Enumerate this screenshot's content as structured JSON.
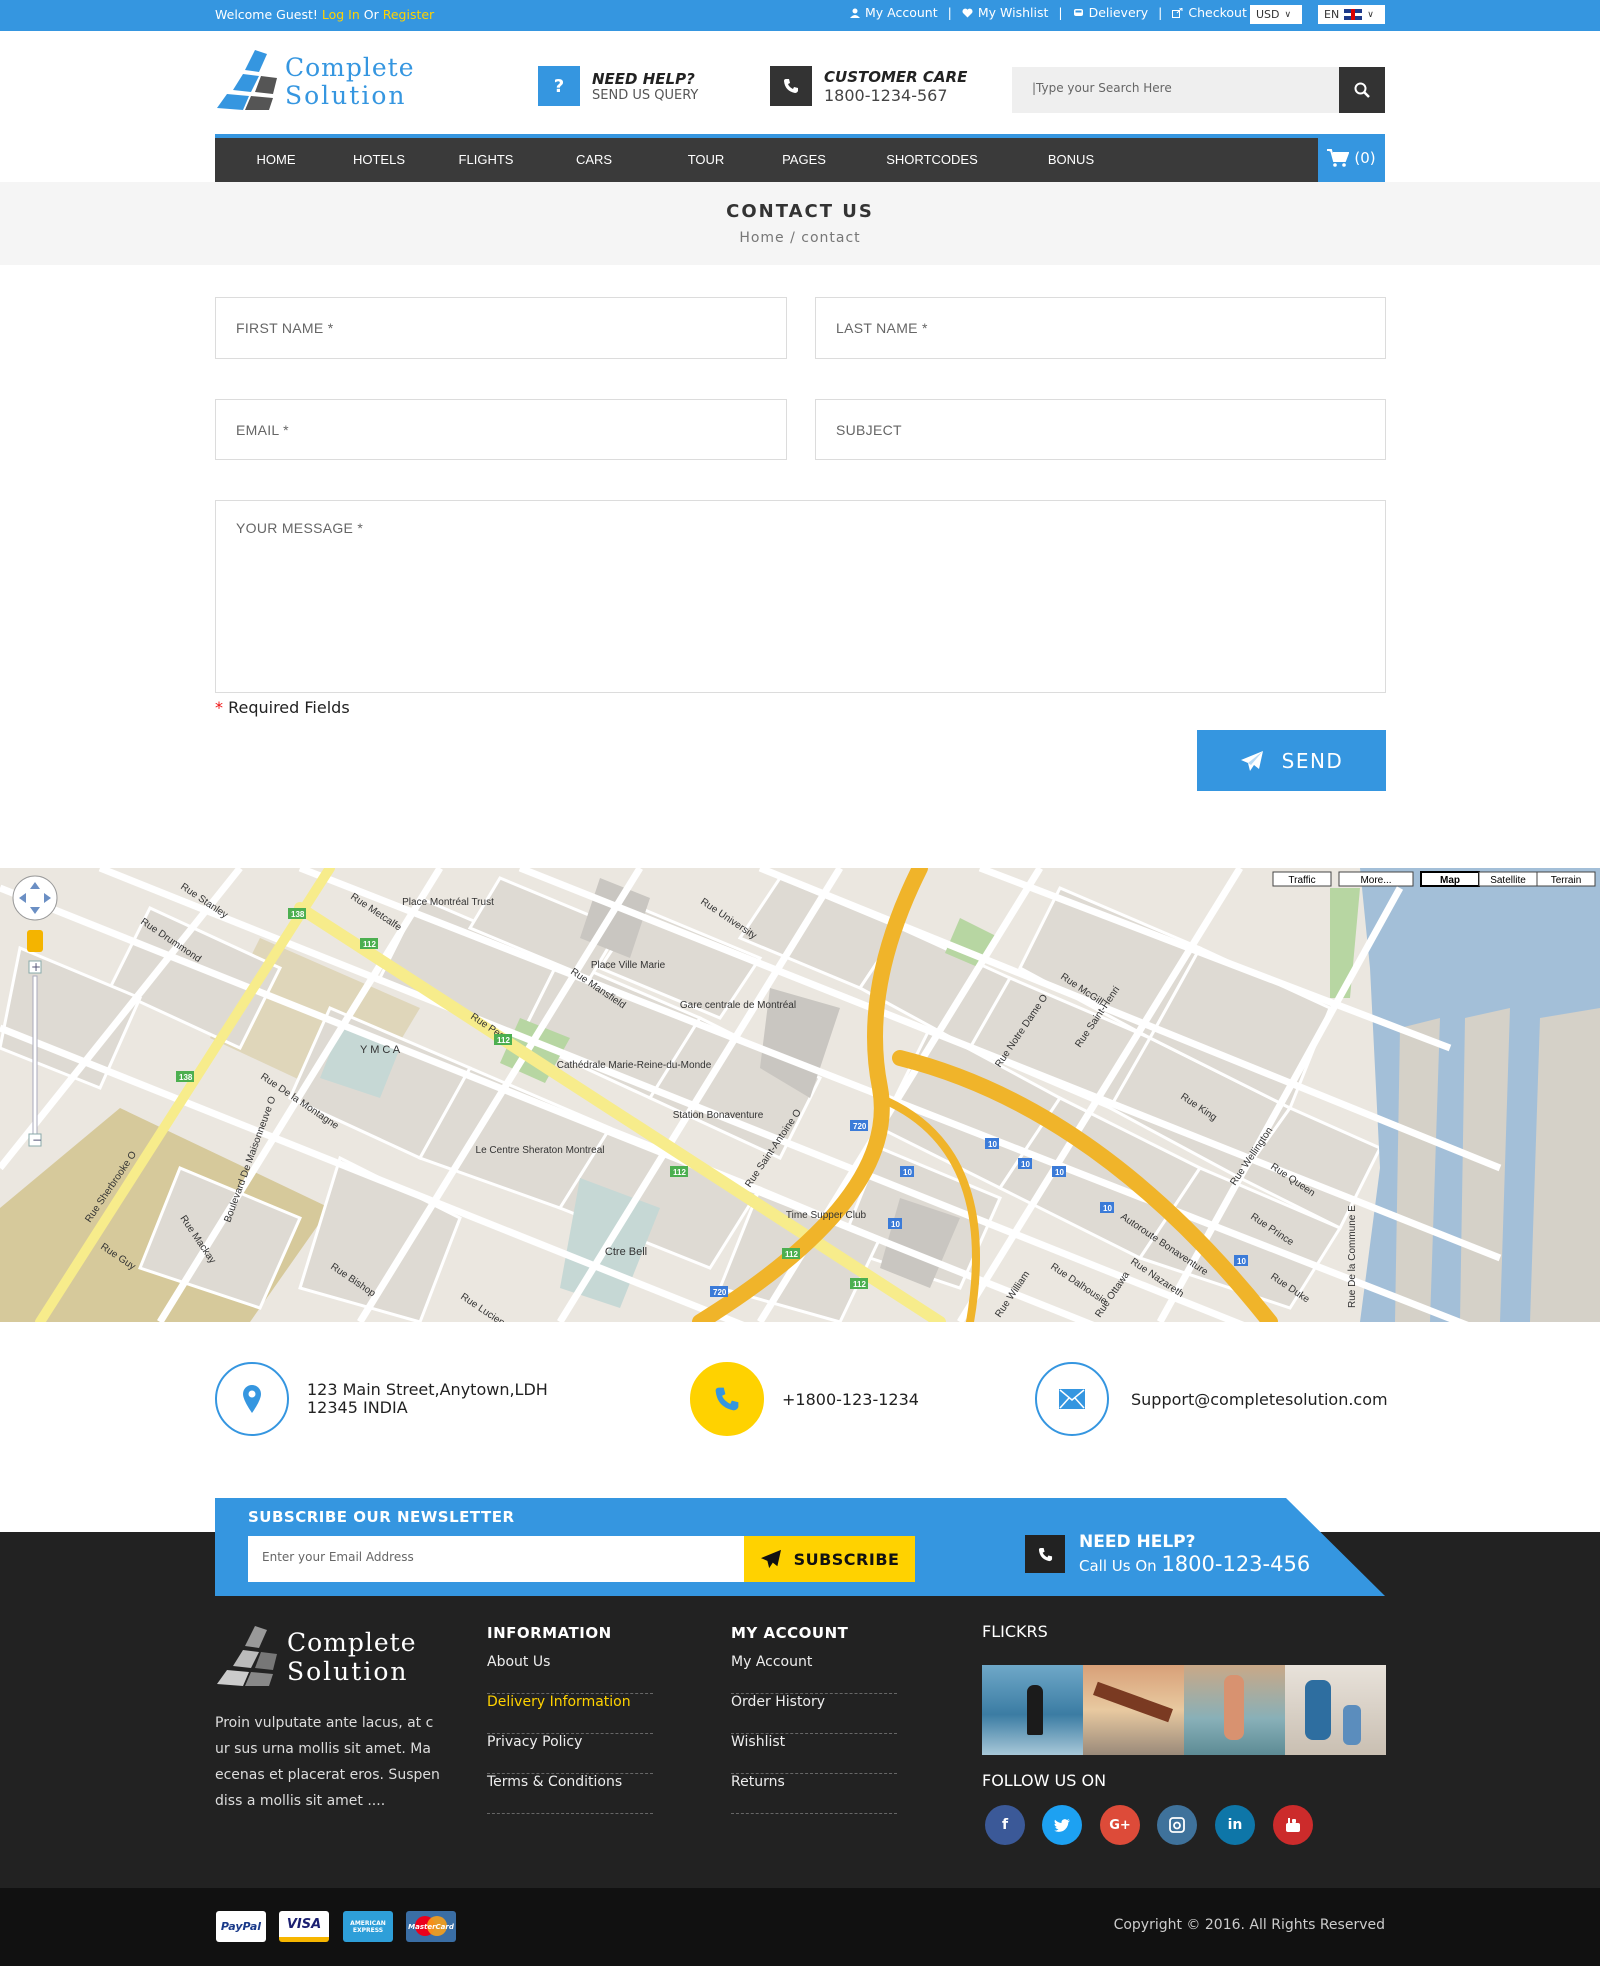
{
  "topbar": {
    "welcome": "Welcome Guest!",
    "login": "Log In",
    "or": "Or",
    "register": "Register",
    "links": [
      "My Account",
      "My Wishlist",
      "Delievery",
      "Checkout"
    ],
    "currency": "USD",
    "language": "EN"
  },
  "header": {
    "logo_line1": "Complete",
    "logo_line2": "Solution",
    "help_title": "NEED HELP?",
    "help_sub": "SEND US QUERY",
    "care_title": "CUSTOMER CARE",
    "care_phone": "1800-1234-567",
    "search_placeholder": "|Type your Search Here"
  },
  "nav": {
    "items": [
      "HOME",
      "HOTELS",
      "FLIGHTS",
      "CARS",
      "TOUR",
      "PAGES",
      "SHORTCODES",
      "BONUS"
    ],
    "cart": "(0)"
  },
  "page": {
    "title": "CONTACT US",
    "crumb_home": "Home",
    "crumb_sep": "/",
    "crumb_current": "contact"
  },
  "form": {
    "first_name": "FIRST NAME *",
    "last_name": "LAST NAME *",
    "email": "EMAIL *",
    "subject": "SUBJECT",
    "message": "YOUR MESSAGE *",
    "required_star": "*",
    "required_text": "Required Fields",
    "send": "SEND"
  },
  "map": {
    "buttons": [
      "Traffic",
      "More...",
      "Map",
      "Satellite",
      "Terrain"
    ],
    "labels": [
      "Place Montréal Trust",
      "Place Ville Marie",
      "Y M C A",
      "Gare centrale de Montréal",
      "Station Bonaventure",
      "Cathédrale Marie-Reine-du-Monde",
      "Rue Peel",
      "Rue Stanley",
      "Rue Drummond",
      "Rue Metcalfe",
      "Rue Mansfield",
      "Rue University",
      "Rue Saint-Antoine O",
      "Autoroute Bonaventure",
      "Rue Notre Dame O",
      "Rue McGill",
      "Rue Wellington",
      "Rue King",
      "Rue Prince",
      "Rue Duke",
      "Rue Queen",
      "Rue Sherbrooke O",
      "Boulevard De Maisonneuve O",
      "Ctre Bell",
      "Time Supper Club",
      "Le Centre Sheraton Montreal",
      "Rue De la Montagne",
      "Rue Guy",
      "Rue Mackay",
      "Rue Bishop",
      "Rue Lucien L'Allier",
      "Rue De la Commune E",
      "Rue Nazareth",
      "Rue Ottawa",
      "Rue William",
      "Rue Dalhousie",
      "Rue Saint-Henri"
    ]
  },
  "contact_info": {
    "address_line1": "123 Main Street,Anytown,LDH",
    "address_line2": "12345 INDIA",
    "phone": "+1800-123-1234",
    "email": "Support@completesolution.com"
  },
  "newsletter": {
    "heading": "SUBSCRIBE OUR NEWSLETTER",
    "placeholder": "Enter your Email Address",
    "button": "SUBSCRIBE",
    "need_help": "NEED HELP?",
    "call_label": "Call Us On",
    "call_number": "1800-123-456"
  },
  "footer": {
    "about": "Proin vulputate ante lacus, at c ur sus urna mollis sit amet. Ma ecenas et placerat eros. Suspen diss a mollis sit amet ....",
    "info_heading": "INFORMATION",
    "info_links": [
      "About Us",
      "Delivery Information",
      "Privacy Policy",
      "Terms & Conditions"
    ],
    "account_heading": "MY ACCOUNT",
    "account_links": [
      "My Account",
      "Order History",
      "Wishlist",
      "Returns"
    ],
    "flickrs_heading": "FLICKRS",
    "follow_heading": "FOLLOW US ON",
    "social": [
      "facebook-icon",
      "twitter-icon",
      "google-plus-icon",
      "instagram-icon",
      "linkedin-icon",
      "youtube-icon"
    ],
    "payments": [
      "PayPal",
      "VISA",
      "AMERICAN EXPRESS",
      "MasterCard"
    ],
    "copyright": "Copyright © 2016. All Rights Reserved"
  },
  "colors": {
    "accent": "#3596e0",
    "yellow": "#ffd200",
    "dark": "#222222"
  }
}
